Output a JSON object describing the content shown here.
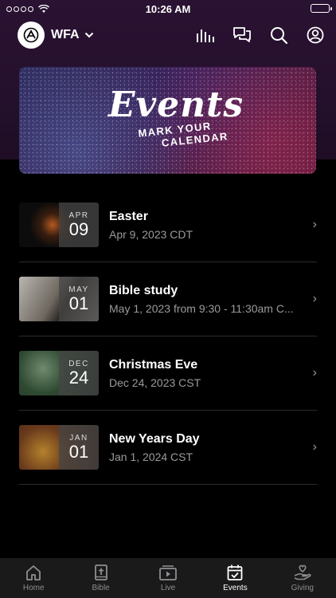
{
  "status_bar": {
    "time": "10:26 AM"
  },
  "header": {
    "org_name": "WFA"
  },
  "banner": {
    "title": "Events",
    "subtitle_line1": "MARK YOUR",
    "subtitle_line2": "CALENDAR"
  },
  "events": [
    {
      "month": "APR",
      "day": "09",
      "title": "Easter",
      "date": "Apr 9, 2023 CDT"
    },
    {
      "month": "MAY",
      "day": "01",
      "title": "Bible study",
      "date": "May 1, 2023 from 9:30 - 11:30am C..."
    },
    {
      "month": "DEC",
      "day": "24",
      "title": "Christmas Eve",
      "date": "Dec 24, 2023 CST"
    },
    {
      "month": "JAN",
      "day": "01",
      "title": "New Years Day",
      "date": "Jan 1, 2024 CST"
    }
  ],
  "tabs": [
    {
      "label": "Home",
      "icon": "home-icon"
    },
    {
      "label": "Bible",
      "icon": "bible-icon"
    },
    {
      "label": "Live",
      "icon": "live-icon"
    },
    {
      "label": "Events",
      "icon": "calendar-icon",
      "active": true
    },
    {
      "label": "Giving",
      "icon": "giving-icon"
    }
  ]
}
